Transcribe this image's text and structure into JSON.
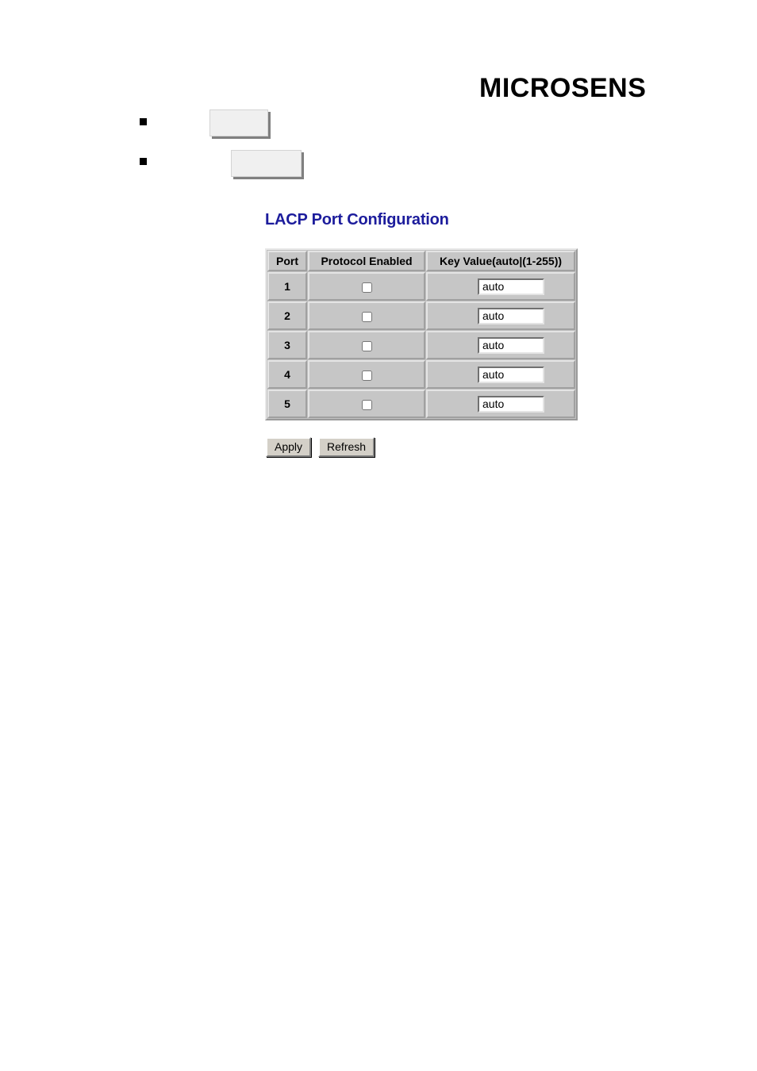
{
  "brand": {
    "name": "MICROSENS"
  },
  "intro": {
    "bullets": [
      {
        "marker": "square-bullet",
        "field_value": ""
      },
      {
        "marker": "square-bullet",
        "field_value": ""
      }
    ]
  },
  "page": {
    "heading": "LACP Port Configuration",
    "heading_color": "#1c1c9c"
  },
  "table": {
    "columns": [
      {
        "key": "port",
        "label": "Port"
      },
      {
        "key": "proto",
        "label": "Protocol Enabled"
      },
      {
        "key": "key",
        "label": "Key Value(auto|(1-255))"
      }
    ],
    "rows": [
      {
        "port": "1",
        "protocol_enabled": false,
        "key_value": "auto"
      },
      {
        "port": "2",
        "protocol_enabled": false,
        "key_value": "auto"
      },
      {
        "port": "3",
        "protocol_enabled": false,
        "key_value": "auto"
      },
      {
        "port": "4",
        "protocol_enabled": false,
        "key_value": "auto"
      },
      {
        "port": "5",
        "protocol_enabled": false,
        "key_value": "auto"
      }
    ]
  },
  "actions": {
    "apply_label": "Apply",
    "refresh_label": "Refresh"
  },
  "theme": {
    "page_background": "#ffffff",
    "table_cell_background": "#c6c6c6",
    "button_face": "#d4d0c8",
    "field_background": "#f0f0f0",
    "text_color": "#000000"
  }
}
